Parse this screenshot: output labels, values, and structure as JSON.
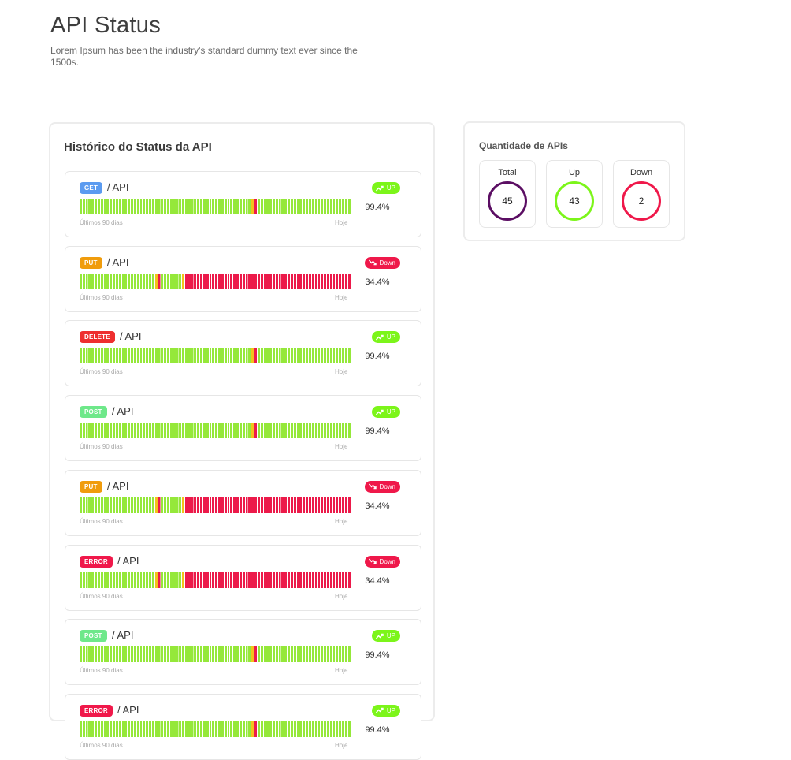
{
  "header": {
    "title": "API Status",
    "subtitle": "Lorem Ipsum has been the industry's standard dummy text ever since the 1500s."
  },
  "history": {
    "title": "Histórico do Status da API",
    "range_start": "Últimos 90 dias",
    "range_end": "Hoje",
    "items": [
      {
        "method": "GET",
        "method_color": "#5b9bf0",
        "path": "/ API",
        "status": "UP",
        "uptime": "99.4%"
      },
      {
        "method": "PUT",
        "method_color": "#f09c0c",
        "path": "/ API",
        "status": "Down",
        "uptime": "34.4%"
      },
      {
        "method": "DELETE",
        "method_color": "#ee2f2f",
        "path": "/ API",
        "status": "UP",
        "uptime": "99.4%"
      },
      {
        "method": "POST",
        "method_color": "#6ee88a",
        "path": "/ API",
        "status": "UP",
        "uptime": "99.4%"
      },
      {
        "method": "PUT",
        "method_color": "#f09c0c",
        "path": "/ API",
        "status": "Down",
        "uptime": "34.4%"
      },
      {
        "method": "ERROR",
        "method_color": "#f0184a",
        "path": "/ API",
        "status": "Down",
        "uptime": "34.4%"
      },
      {
        "method": "POST",
        "method_color": "#6ee88a",
        "path": "/ API",
        "status": "UP",
        "uptime": "99.4%"
      },
      {
        "method": "ERROR",
        "method_color": "#f0184a",
        "path": "/ API",
        "status": "UP",
        "uptime": "99.4%"
      }
    ]
  },
  "counts": {
    "title": "Quantidade de APIs",
    "items": [
      {
        "label": "Total",
        "value": "45",
        "color": "#5b0e63"
      },
      {
        "label": "Up",
        "value": "43",
        "color": "#7cf51a"
      },
      {
        "label": "Down",
        "value": "2",
        "color": "#ef184a"
      }
    ]
  },
  "colors": {
    "up": "#7cf51a",
    "down": "#ef184a",
    "bar_up": "#95e83a",
    "bar_down": "#ec1a4a",
    "bar_warn": "#f3c21b"
  }
}
